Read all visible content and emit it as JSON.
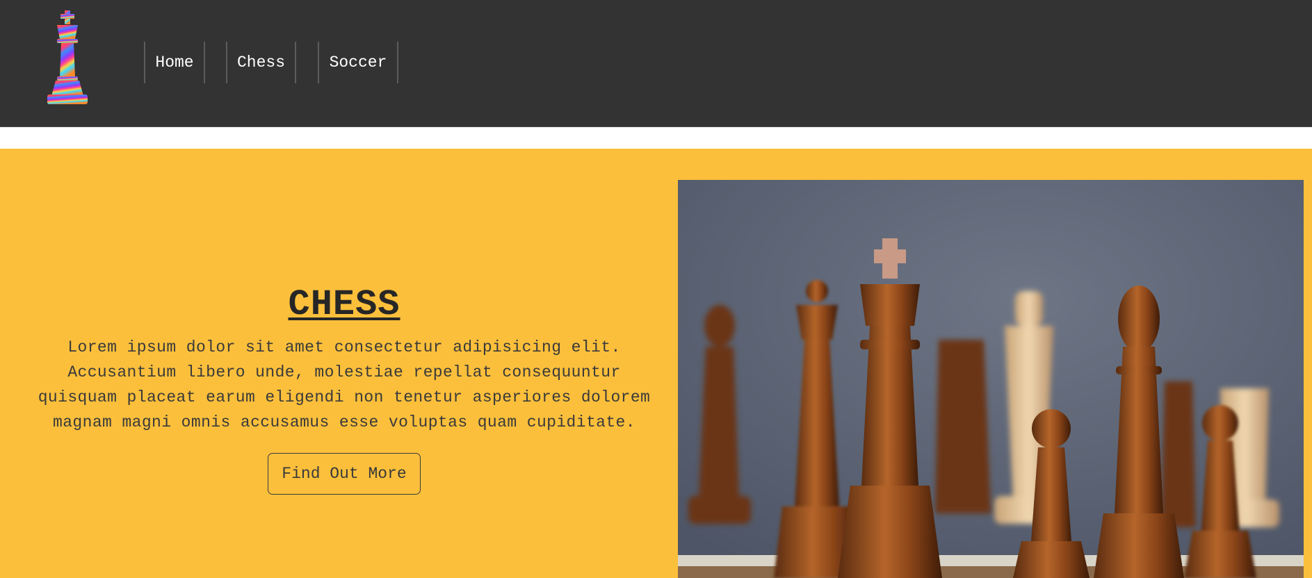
{
  "nav": {
    "items": [
      {
        "label": "Home"
      },
      {
        "label": "Chess"
      },
      {
        "label": "Soccer"
      }
    ]
  },
  "hero": {
    "title": "CHESS",
    "body": "Lorem ipsum dolor sit amet consectetur adipisicing elit. Accusantium libero unde, molestiae repellat consequuntur quisquam placeat earum eligendi non tenetur asperiores dolorem magnam magni omnis accusamus esse voluptas quam cupiditate.",
    "cta_label": "Find Out More"
  },
  "colors": {
    "header_bg": "#333333",
    "hero_bg": "#fbbf3b",
    "text_dark": "#3a3a3a"
  },
  "icons": {
    "logo": "rainbow-king-chess-piece-icon"
  }
}
